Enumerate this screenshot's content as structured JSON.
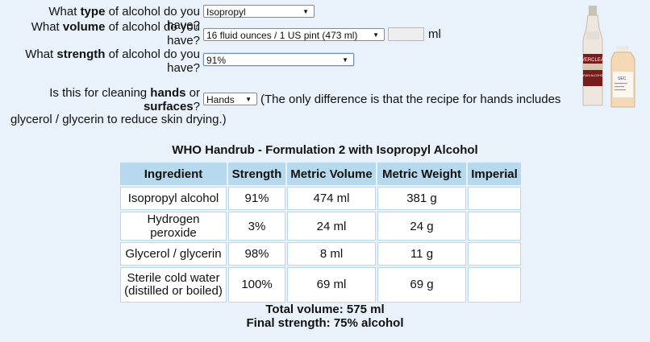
{
  "form": {
    "type_q": {
      "pre": "What ",
      "bold": "type",
      "post": " of alcohol do you have?"
    },
    "type_value": "Isopropyl",
    "volume_q": {
      "pre": "What ",
      "bold": "volume",
      "mid": " of alcohol do you",
      "post": "have?"
    },
    "volume_value": "16 fluid ounces / 1 US pint (473 ml)",
    "volume_custom_value": "",
    "volume_unit": "ml",
    "strength_q": {
      "pre": "What ",
      "bold": "strength",
      "mid": " of alcohol do you",
      "post": "have?"
    },
    "strength_value": "91%",
    "use_q": {
      "pre": "Is this for cleaning ",
      "bold1": "hands",
      "mid": " or",
      "bold2": "surfaces",
      "post": "?"
    },
    "use_value": "Hands",
    "use_note_1": "(The only difference is that the recipe for hands includes",
    "use_note_2": "glycerol / glycerin to reduce skin drying.)"
  },
  "recipe": {
    "title": "WHO Handrub - Formulation 2 with Isopropyl Alcohol",
    "headers": [
      "Ingredient",
      "Strength",
      "Metric Volume",
      "Metric Weight",
      "Imperial"
    ],
    "rows": [
      {
        "ingredient": "Isopropyl alcohol",
        "strength": "91%",
        "volume": "474 ml",
        "weight": "381 g",
        "imperial": ""
      },
      {
        "ingredient": "Hydrogen peroxide",
        "strength": "3%",
        "volume": "24 ml",
        "weight": "24 g",
        "imperial": ""
      },
      {
        "ingredient": "Glycerol / glycerin",
        "strength": "98%",
        "volume": "8 ml",
        "weight": "11 g",
        "imperial": ""
      },
      {
        "ingredient_1": "Sterile cold water",
        "ingredient_2": "(distilled or boiled)",
        "strength": "100%",
        "volume": "69 ml",
        "weight": "69 g",
        "imperial": ""
      }
    ],
    "total_volume": "Total volume: 575 ml",
    "final_strength": "Final strength: 75% alcohol"
  },
  "images": {
    "bottle1_label": "EVERCLEAR",
    "bottle1_sub": "GRAIN ALCOHOL",
    "bottle2_label": "SEC"
  },
  "colors": {
    "background": "#e9f2fb",
    "table_header": "#b7d9ee"
  }
}
